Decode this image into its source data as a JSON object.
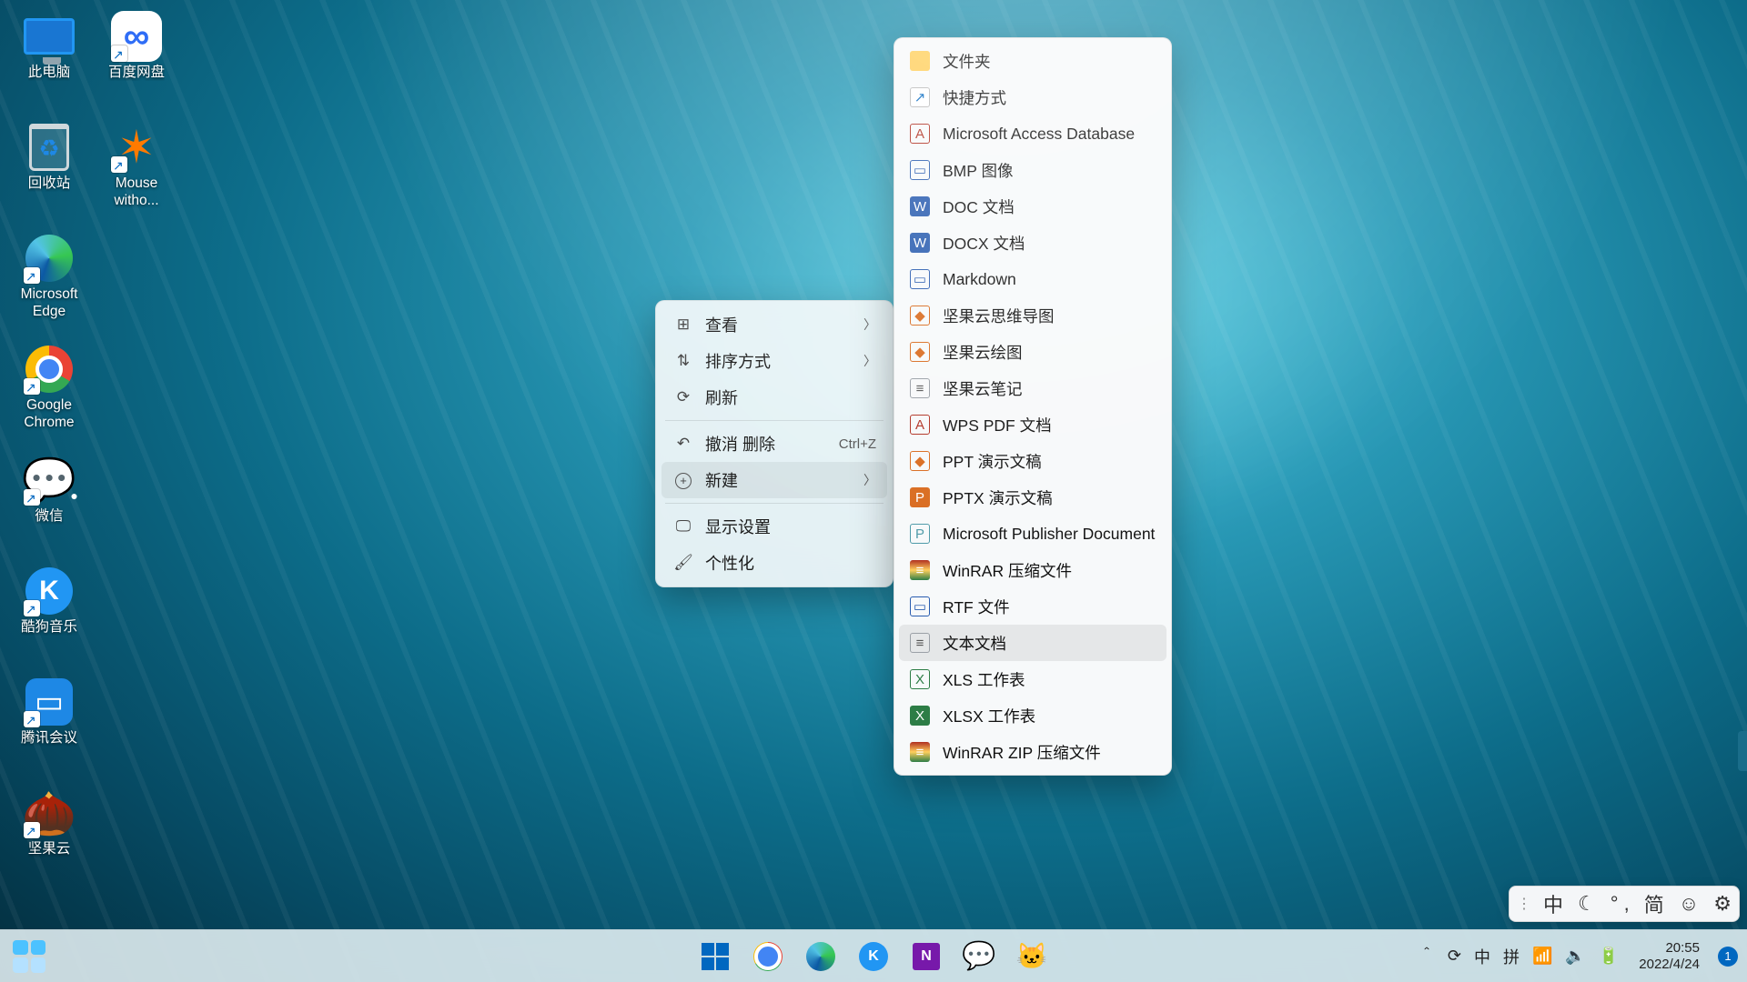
{
  "desktop_icons": [
    {
      "label": "此电脑",
      "icon": "monitor",
      "shortcut": false
    },
    {
      "label": "百度网盘",
      "icon": "baidu",
      "shortcut": true
    },
    {
      "label": "回收站",
      "icon": "bin",
      "shortcut": false
    },
    {
      "label": "Mouse witho...",
      "icon": "mwb",
      "shortcut": true
    },
    {
      "label": "Microsoft Edge",
      "icon": "edge",
      "shortcut": true
    },
    {
      "label": "",
      "icon": "",
      "shortcut": false
    },
    {
      "label": "Google Chrome",
      "icon": "chrome",
      "shortcut": true
    },
    {
      "label": "",
      "icon": "",
      "shortcut": false
    },
    {
      "label": "微信",
      "icon": "wechat",
      "shortcut": true
    },
    {
      "label": "",
      "icon": "",
      "shortcut": false
    },
    {
      "label": "酷狗音乐",
      "icon": "kugou",
      "shortcut": true
    },
    {
      "label": "",
      "icon": "",
      "shortcut": false
    },
    {
      "label": "腾讯会议",
      "icon": "txmeet",
      "shortcut": true
    },
    {
      "label": "",
      "icon": "",
      "shortcut": false
    },
    {
      "label": "坚果云",
      "icon": "nut",
      "shortcut": true
    }
  ],
  "context_menu": {
    "groups": [
      [
        {
          "icon": "view",
          "label": "查看",
          "submenu": true
        },
        {
          "icon": "sort",
          "label": "排序方式",
          "submenu": true
        },
        {
          "icon": "refresh",
          "label": "刷新"
        }
      ],
      [
        {
          "icon": "undo",
          "label": "撤消 删除",
          "hotkey": "Ctrl+Z"
        },
        {
          "icon": "plus",
          "label": "新建",
          "submenu": true,
          "highlighted": true
        }
      ],
      [
        {
          "icon": "display",
          "label": "显示设置"
        },
        {
          "icon": "brush",
          "label": "个性化"
        }
      ]
    ]
  },
  "submenu_new": [
    {
      "fi": "folder",
      "label": "文件夹"
    },
    {
      "fi": "link",
      "label": "快捷方式"
    },
    {
      "fi": "red",
      "label": "Microsoft Access Database"
    },
    {
      "fi": "blue",
      "label": "BMP 图像"
    },
    {
      "fi": "bluef",
      "label": "DOC 文档"
    },
    {
      "fi": "bluef",
      "label": "DOCX 文档"
    },
    {
      "fi": "blue",
      "label": "Markdown"
    },
    {
      "fi": "orange",
      "label": "坚果云思维导图"
    },
    {
      "fi": "orange",
      "label": "坚果云绘图"
    },
    {
      "fi": "gray",
      "label": "坚果云笔记"
    },
    {
      "fi": "red",
      "label": "WPS PDF 文档"
    },
    {
      "fi": "orange",
      "label": "PPT 演示文稿"
    },
    {
      "fi": "orangef",
      "label": "PPTX 演示文稿"
    },
    {
      "fi": "teal",
      "label": "Microsoft Publisher Document"
    },
    {
      "fi": "rar",
      "label": "WinRAR 压缩文件"
    },
    {
      "fi": "blue",
      "label": "RTF 文件"
    },
    {
      "fi": "gray",
      "label": "文本文档",
      "highlighted": true
    },
    {
      "fi": "green",
      "label": "XLS 工作表"
    },
    {
      "fi": "greenf",
      "label": "XLSX 工作表"
    },
    {
      "fi": "rar",
      "label": "WinRAR ZIP 压缩文件"
    }
  ],
  "ime_bar": [
    "中",
    "☾",
    "° ,",
    "简",
    "☺",
    "⚙"
  ],
  "taskbar": {
    "pinned": [
      "start",
      "chrome",
      "edge",
      "kugou",
      "onenote",
      "wechat",
      "cat"
    ],
    "tray_icons": [
      "＾",
      "⟳",
      "中",
      "拼",
      "📶",
      "🔈",
      "🔋"
    ],
    "time": "20:55",
    "date": "2022/4/24",
    "notif_count": "1"
  }
}
